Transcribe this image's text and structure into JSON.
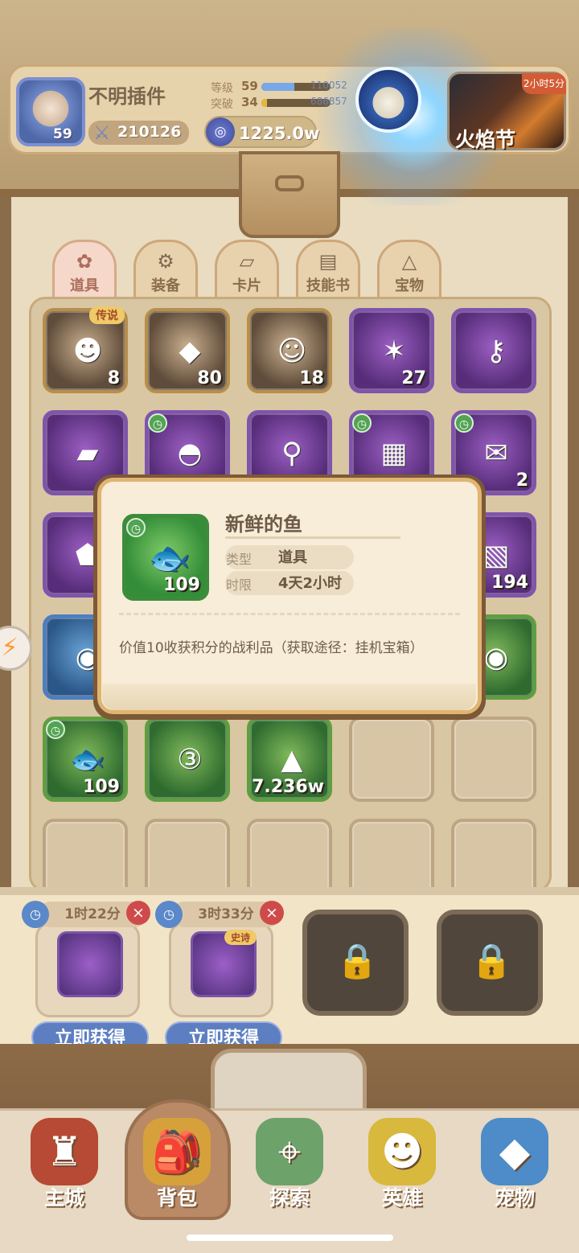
{
  "player": {
    "name": "不明插件",
    "avatar_level": "59",
    "power": "210126",
    "level_label": "等级",
    "level_value": "59",
    "level_progress": "110052",
    "breakthrough_label": "突破",
    "breakthrough_value": "34",
    "breakthrough_progress": "686857"
  },
  "currency": {
    "value": "1225.0w"
  },
  "event": {
    "title": "火焰节",
    "badge": "2小时5分"
  },
  "tabs": [
    {
      "label": "道具",
      "icon": "clover-icon",
      "active": true
    },
    {
      "label": "装备",
      "icon": "gear-icon"
    },
    {
      "label": "卡片",
      "icon": "card-icon"
    },
    {
      "label": "技能书",
      "icon": "book-icon"
    },
    {
      "label": "宝物",
      "icon": "triangle-icon"
    }
  ],
  "inventory": {
    "row1": [
      {
        "count": "8",
        "tag": "传说"
      },
      {
        "count": "80"
      },
      {
        "count": "18"
      },
      {
        "count": "27"
      },
      {
        "count": ""
      }
    ],
    "row2": [
      {
        "count": ""
      },
      {
        "count": ""
      },
      {
        "count": ""
      },
      {
        "count": ""
      },
      {
        "count": "2"
      }
    ],
    "row3": [
      {
        "count": ""
      },
      {
        "count": ""
      },
      {
        "count": ""
      },
      {
        "count": ""
      },
      {
        "count": "194"
      }
    ],
    "row4": [
      {
        "count": ""
      },
      {
        "count": ""
      },
      {
        "count": ""
      },
      {
        "count": ""
      },
      {
        "count": ""
      }
    ],
    "row5": [
      {
        "count": "109"
      },
      {
        "count": ""
      },
      {
        "count": "7.236w"
      },
      {
        "count": ""
      },
      {
        "count": ""
      }
    ]
  },
  "tooltip": {
    "title": "新鲜的鱼",
    "item_count": "109",
    "type_label": "类型",
    "type_value": "道具",
    "duration_label": "时限",
    "duration_value": "4天2小时",
    "description": "价值10收获积分的战利品（获取途径：挂机宝箱）"
  },
  "queue": [
    {
      "time": "1时22分",
      "button": "立即获得",
      "tag": ""
    },
    {
      "time": "3时33分",
      "button": "立即获得",
      "tag": "史诗"
    }
  ],
  "nav": [
    {
      "label": "主城",
      "icon": "castle-icon"
    },
    {
      "label": "背包",
      "icon": "backpack-icon"
    },
    {
      "label": "探索",
      "icon": "map-icon"
    },
    {
      "label": "英雄",
      "icon": "hero-icon"
    },
    {
      "label": "宠物",
      "icon": "pet-icon"
    }
  ],
  "colors": {
    "accent": "#5d7fc2",
    "positive": "#52a352",
    "danger": "#cf4b4b"
  }
}
